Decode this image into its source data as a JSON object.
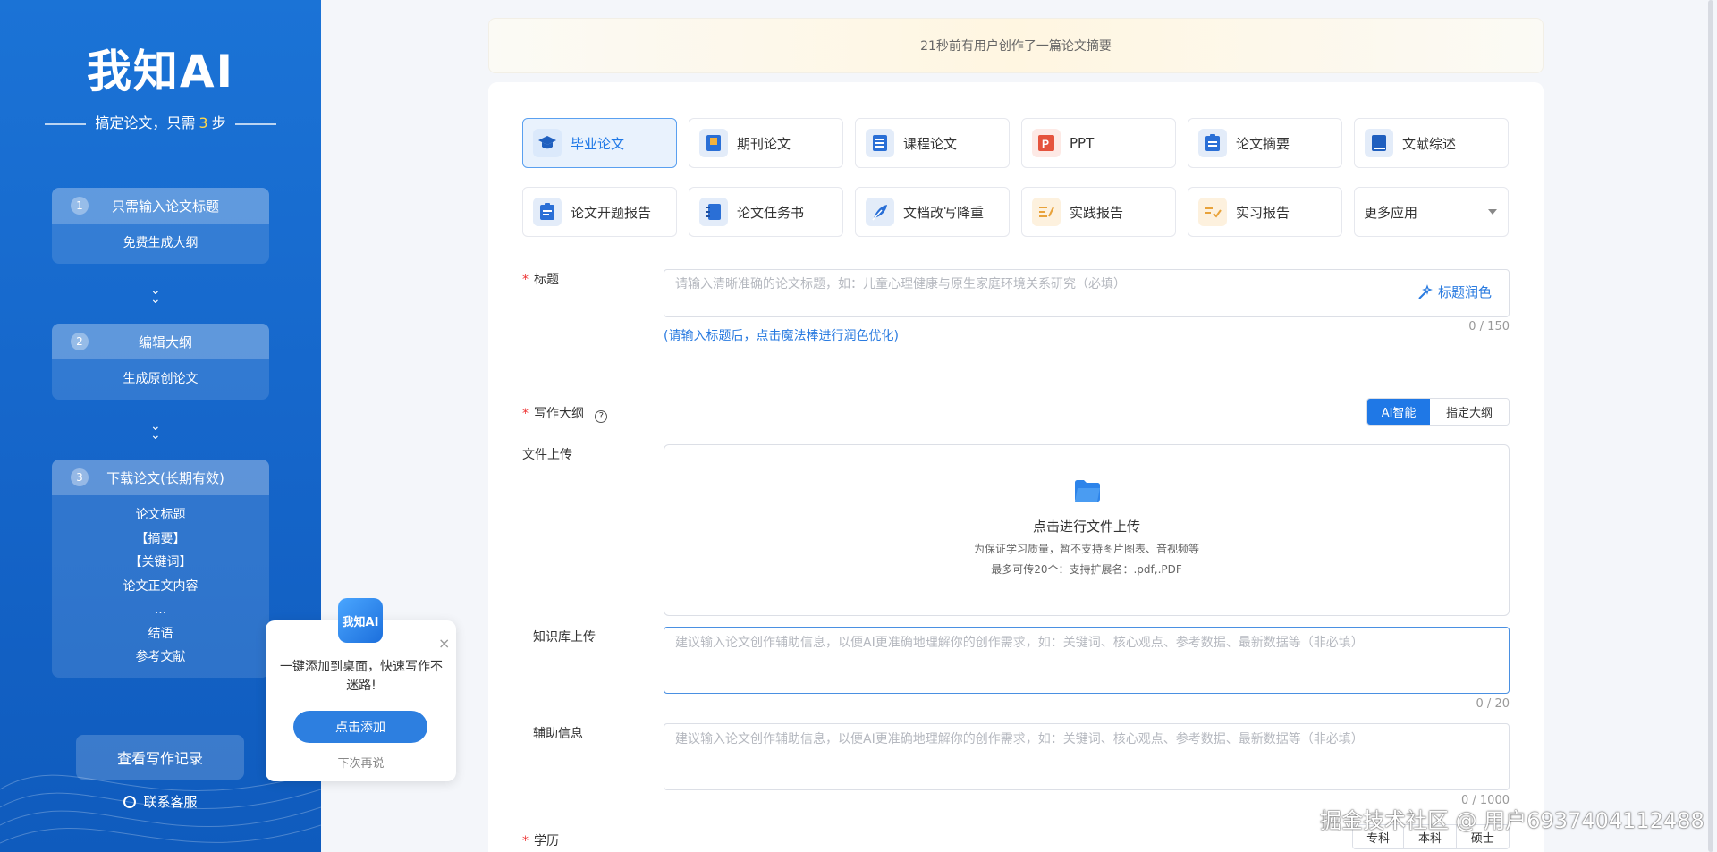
{
  "sidebar": {
    "logo": "我知AI",
    "tagline_pre": "搞定论文，只需",
    "tagline_num": "3",
    "tagline_post": "步",
    "steps": [
      {
        "num": "1",
        "title": "只需输入论文标题",
        "items": [
          "免费生成大纲"
        ]
      },
      {
        "num": "2",
        "title": "编辑大纲",
        "items": [
          "生成原创论文"
        ]
      },
      {
        "num": "3",
        "title": "下载论文(长期有效)",
        "items": [
          "论文标题",
          "【摘要】",
          "【关键词】",
          "论文正文内容",
          "...",
          "结语",
          "参考文献"
        ]
      }
    ],
    "arrow": "⌄",
    "history_button": "查看写作记录",
    "contact": "联系客服"
  },
  "banner": "21秒前有用户创作了一篇论文摘要",
  "types": [
    {
      "label": "毕业论文",
      "icon": "graduation-cap-icon",
      "color": "#1f78e6",
      "bg": "#dbe9fb"
    },
    {
      "label": "期刊论文",
      "icon": "journal-icon",
      "color": "#2a6fd6",
      "bg": "#e3ecf9"
    },
    {
      "label": "课程论文",
      "icon": "course-list-icon",
      "color": "#2a6fd6",
      "bg": "#e3ecf9"
    },
    {
      "label": "PPT",
      "icon": "ppt-icon",
      "color": "#e5533d",
      "bg": "#fde9e5"
    },
    {
      "label": "论文摘要",
      "icon": "clipboard-icon",
      "color": "#2a6fd6",
      "bg": "#e3ecf9"
    },
    {
      "label": "文献综述",
      "icon": "book-icon",
      "color": "#2a6fd6",
      "bg": "#e3ecf9"
    },
    {
      "label": "论文开题报告",
      "icon": "report-icon",
      "color": "#2a6fd6",
      "bg": "#e3ecf9"
    },
    {
      "label": "论文任务书",
      "icon": "notebook-icon",
      "color": "#2a6fd6",
      "bg": "#e3ecf9"
    },
    {
      "label": "文档改写降重",
      "icon": "feather-icon",
      "color": "#2a6fd6",
      "bg": "#e3ecf9"
    },
    {
      "label": "实践报告",
      "icon": "practice-icon",
      "color": "#e8a23a",
      "bg": "#fdf1de"
    },
    {
      "label": "实习报告",
      "icon": "internship-icon",
      "color": "#e8a23a",
      "bg": "#fdf1de"
    }
  ],
  "more_apps": "更多应用",
  "form": {
    "title_label": "标题",
    "title_placeholder": "请输入清晰准确的论文标题，如：儿童心理健康与原生家庭环境关系研究（必填）",
    "title_polish": "标题润色",
    "title_counter": "0 / 150",
    "title_hint": "(请输入标题后，点击魔法棒进行润色优化)",
    "outline_label": "写作大纲",
    "outline_ai": "AI智能",
    "outline_custom": "指定大纲",
    "upload_label": "文件上传",
    "upload_title": "点击进行文件上传",
    "upload_sub1": "为保证学习质量，暂不支持图片图表、音视频等",
    "upload_sub2": "最多可传20个：支持扩展名：.pdf,.PDF",
    "kb_label": "知识库上传",
    "kb_placeholder": "建议输入论文创作辅助信息，以便AI更准确地理解你的创作需求，如：关键词、核心观点、参考数据、最新数据等（非必填）",
    "kb_counter": "0 / 20",
    "aux_label": "辅助信息",
    "aux_placeholder": "建议输入论文创作辅助信息，以便AI更准确地理解你的创作需求，如：关键词、核心观点、参考数据、最新数据等（非必填）",
    "aux_counter": "0 / 1000",
    "edu_label": "学历",
    "edu_options": [
      "专科",
      "本科",
      "硕士"
    ]
  },
  "popup": {
    "logo": "我知AI",
    "text": "一键添加到桌面，快速写作不迷路!",
    "button": "点击添加",
    "later": "下次再说",
    "close": "×"
  },
  "watermark": "掘金技术社区 @ 用户6937404112488"
}
